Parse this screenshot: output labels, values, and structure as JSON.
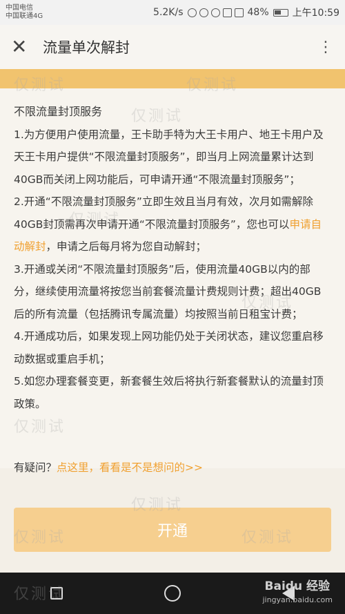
{
  "status_bar": {
    "carrier_1": "中国电信",
    "carrier_2": "中国联通4G",
    "speed": "5.2K/s",
    "battery": "48%",
    "time": "上午10:59"
  },
  "header": {
    "title": "流量单次解封",
    "close_icon": "close-icon",
    "more_icon": "more-icon"
  },
  "content": {
    "heading": "不限流量封顶服务",
    "p1": "1.为方便用户使用流量，王卡助手特为大王卡用户、地王卡用户及天王卡用户提供“不限流量封顶服务”，即当月上网流量累计达到40GB而关闭上网功能后，可申请开通“不限流量封顶服务”；",
    "p2_a": "2.开通“不限流量封顶服务”立即生效且当月有效，次月如需解除40GB封顶需再次申请开通“不限流量封顶服务”，您也可以",
    "p2_link": "申请自动解封",
    "p2_b": "，申请之后每月将为您自动解封；",
    "p3": "3.开通或关闭“不限流量封顶服务”后，使用流量40GB以内的部分，继续使用流量将按您当前套餐流量计费规则计费；超出40GB后的所有流量（包括腾讯专属流量）均按照当前日租宝计费；",
    "p4": "4.开通成功后，如果发现上网功能仍处于关闭状态，建议您重启移动数据或重启手机；",
    "p5": "5.如您办理套餐变更，新套餐生效后将执行新套餐默认的流量封顶政策。"
  },
  "faq": {
    "prefix": "有疑问？",
    "link": "点这里，看看是不是想问的>>"
  },
  "action": {
    "button_label": "开通"
  },
  "watermark": {
    "text": "仅测试",
    "site": "jingyan.baidu.com",
    "logo": "Baidu 经验"
  },
  "colors": {
    "accent": "#f0a030",
    "band": "#f1c36e",
    "button": "#f6cf8f"
  }
}
